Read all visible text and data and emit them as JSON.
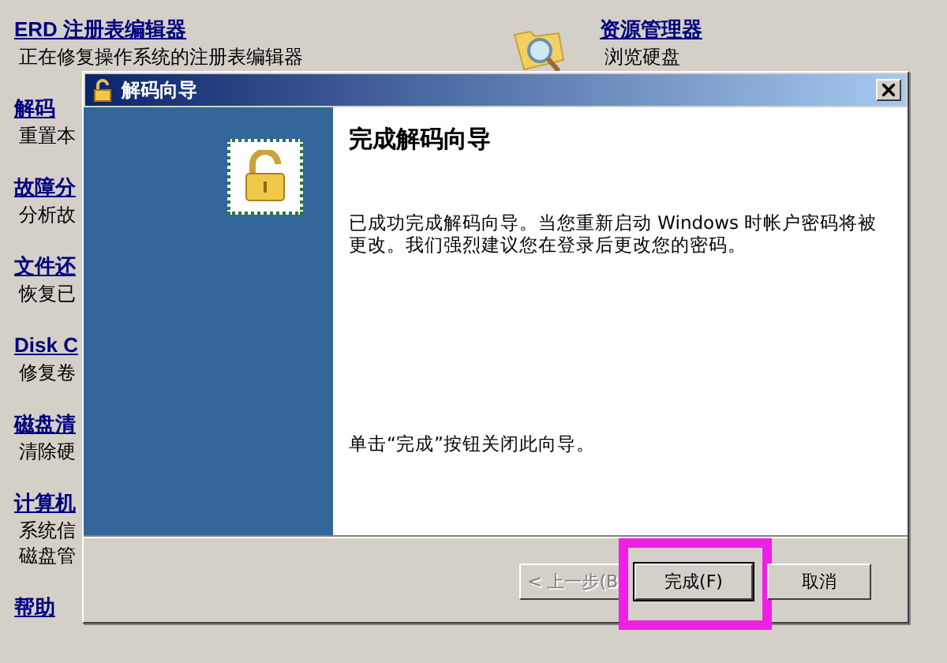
{
  "tools_left": [
    {
      "title": "ERD 注册表编辑器",
      "descriptions": [
        "正在修复操作系统的注册表编辑器"
      ]
    },
    {
      "title": "解码",
      "descriptions": [
        "重置本"
      ]
    },
    {
      "title": "故障分",
      "descriptions": [
        "分析故"
      ]
    },
    {
      "title": "文件还",
      "descriptions": [
        "恢复已"
      ]
    },
    {
      "title": "Disk C",
      "descriptions": [
        "修复卷"
      ]
    },
    {
      "title": "磁盘清",
      "descriptions": [
        "清除硬"
      ]
    },
    {
      "title": "计算机",
      "descriptions": [
        "系统信",
        "磁盘管"
      ]
    },
    {
      "title": "帮助"
    }
  ],
  "tools_right": [
    {
      "title": "资源管理器",
      "descriptions": [
        "浏览硬盘"
      ]
    }
  ],
  "dialog": {
    "title": "解码向导",
    "heading": "完成解码向导",
    "body": "已成功完成解码向导。当您重新启动 Windows 时帐户密码将被更改。我们强烈建议您在登录后更改您的密码。",
    "hint": "单击“完成”按钮关闭此向导。",
    "buttons": [
      {
        "label": "< 上一步(B",
        "kind": "back",
        "disabled": true,
        "default": false,
        "highlighted": false
      },
      {
        "label": "完成(F)",
        "kind": "finish",
        "disabled": false,
        "default": true,
        "highlighted": true
      },
      {
        "label": "取消",
        "kind": "cancel",
        "disabled": false,
        "default": false,
        "highlighted": false
      }
    ]
  }
}
